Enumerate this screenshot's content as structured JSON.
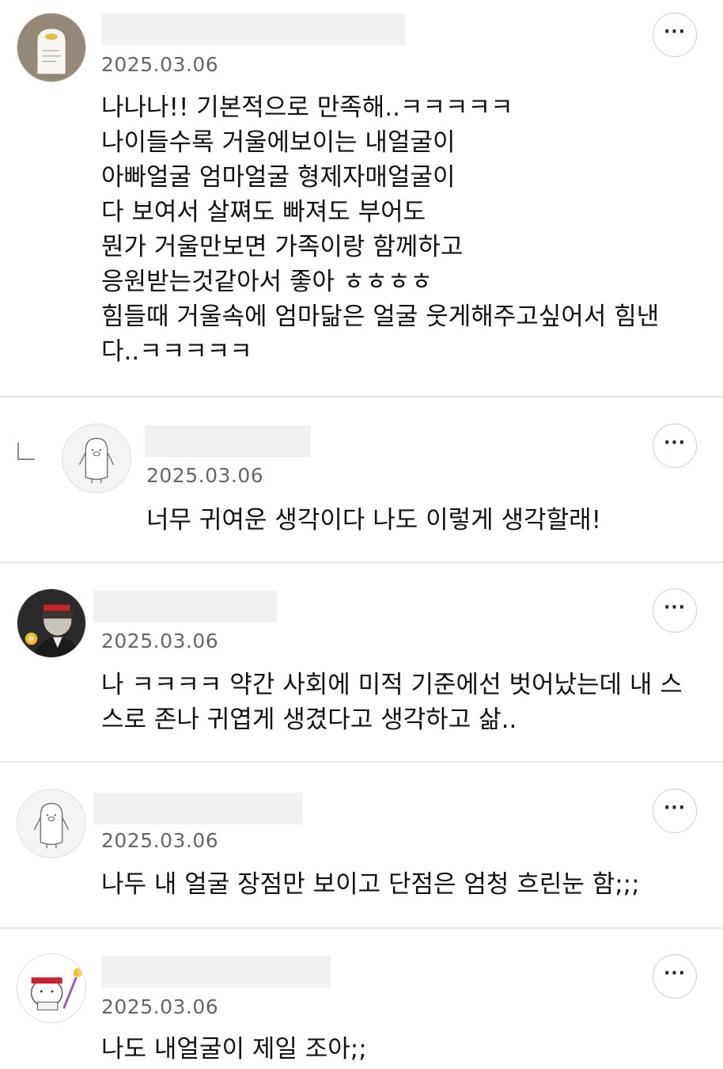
{
  "comments": [
    {
      "avatar": "note-card-avatar",
      "date": "2025.03.06",
      "more_label": "···",
      "text": "나나나!! 기본적으로 만족해..ㅋㅋㅋㅋㅋ\n나이들수록 거울에보이는 내얼굴이\n아빠얼굴 엄마얼굴 형제자매얼굴이\n다 보여서 살쪄도 빠져도 부어도\n뭔가 거울만보면 가족이랑 함께하고\n응원받는것같아서 좋아 ㅎㅎㅎㅎ\n힘들때 거울속에 엄마닮은 얼굴 웃게해주고싶어서 힘낸\n다..ㅋㅋㅋㅋㅋ"
    },
    {
      "avatar": "default-penguin-avatar",
      "is_reply": true,
      "date": "2025.03.06",
      "more_label": "···",
      "text": "너무 귀여운 생각이다 나도 이렇게 생각할래!"
    },
    {
      "avatar": "dark-portrait-avatar",
      "date": "2025.03.06",
      "more_label": "···",
      "text": "나 ㅋㅋㅋㅋ 약간 사회에 미적 기준에선 벗어났는데 내 스\n스로 존나 귀엽게 생겼다고 생각하고 삶.."
    },
    {
      "avatar": "default-penguin-avatar",
      "date": "2025.03.06",
      "more_label": "···",
      "text": "나두 내 얼굴 장점만 보이고 단점은 엄청 흐린눈 함;;;"
    },
    {
      "avatar": "cartoon-rabbit-avatar",
      "date": "2025.03.06",
      "more_label": "···",
      "text": "나도 내얼굴이 제일 조아;;"
    }
  ]
}
